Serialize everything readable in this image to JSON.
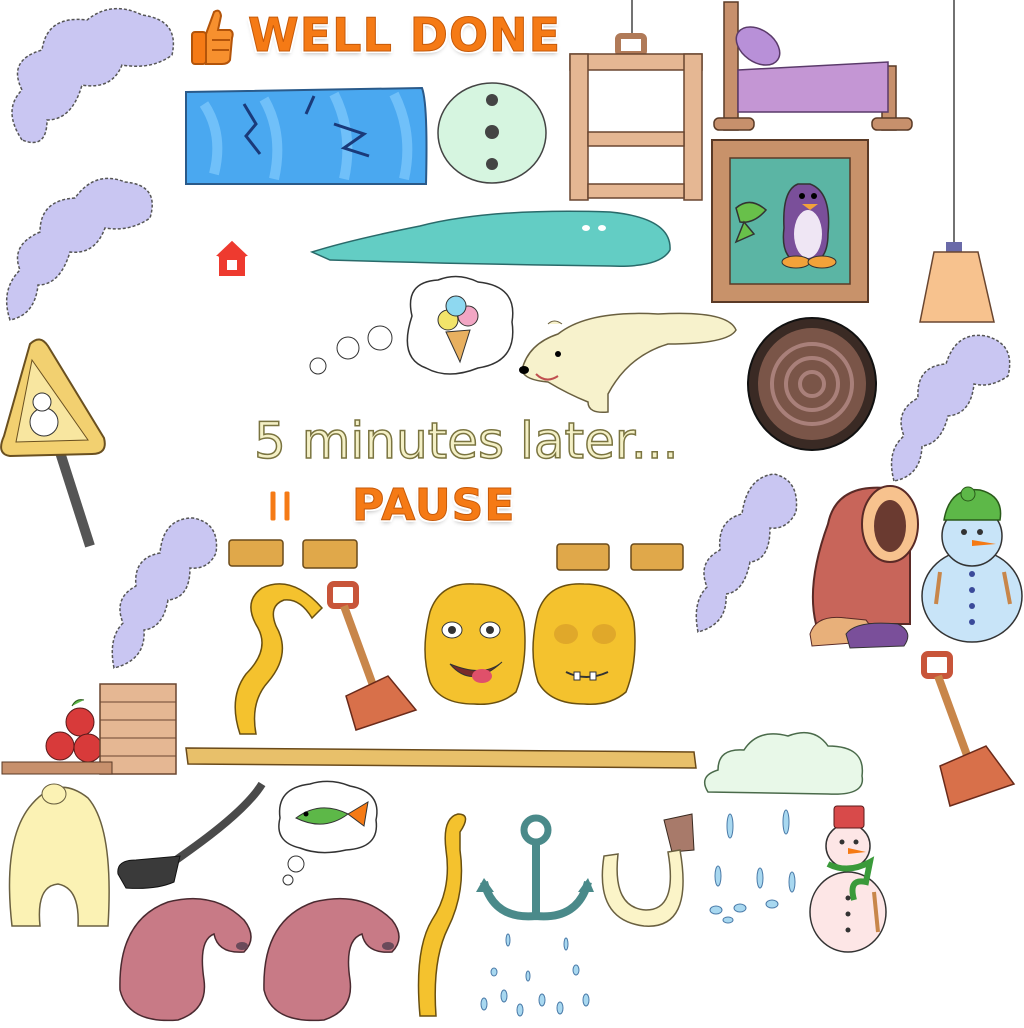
{
  "hud": {
    "well_done_label": "WELL DONE",
    "later_label": "5 minutes later...",
    "pause_label": "PAUSE"
  },
  "icons": {
    "thumbs_up": "thumbs-up-icon",
    "home": "home-icon",
    "pause": "pause-icon"
  },
  "colors": {
    "accent_orange": "#f57a15",
    "cloud_lavender": "#c9c6f2",
    "ice_blue": "#4aa8f0",
    "snow_white": "#e8f4ff"
  }
}
